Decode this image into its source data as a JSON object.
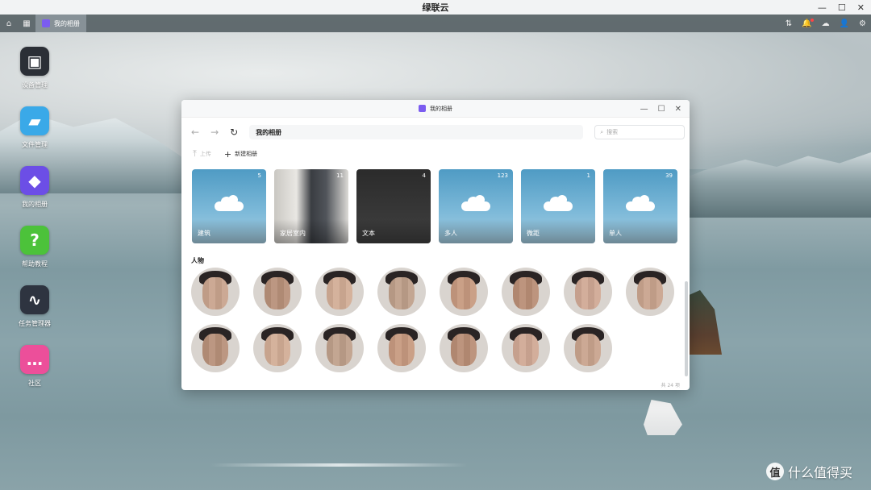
{
  "os": {
    "title": "绿联云",
    "controls": [
      "—",
      "☐",
      "✕"
    ]
  },
  "taskbar": {
    "home_glyph": "⌂",
    "apps_glyph": "▦",
    "active_app": "我的相册",
    "right_glyphs": [
      "⇅",
      "🔔",
      "☁",
      "👤",
      "⚙"
    ]
  },
  "desktop": {
    "items": [
      {
        "label": "设备管理",
        "glyph": "▣",
        "color": "#2b2f36"
      },
      {
        "label": "文件管理",
        "glyph": "▰",
        "color": "#3aa9e8"
      },
      {
        "label": "我的相册",
        "glyph": "◆",
        "color": "#6c4ee6"
      },
      {
        "label": "帮助教程",
        "glyph": "?",
        "color": "#4cc23a"
      },
      {
        "label": "任务管理器",
        "glyph": "∿",
        "color": "#2e3440"
      },
      {
        "label": "社区",
        "glyph": "…",
        "color": "#ec4f9a"
      }
    ]
  },
  "window": {
    "title": "我的相册",
    "controls": [
      "—",
      "☐",
      "✕"
    ],
    "nav": {
      "back": "←",
      "forward": "→",
      "refresh": "↻"
    },
    "path": "我的相册",
    "search_placeholder": "搜索",
    "toolbar": {
      "upload": "上传",
      "new_album": "新建相册"
    },
    "albums": [
      {
        "name": "建筑",
        "count": "5"
      },
      {
        "name": "家居室内",
        "count": "11"
      },
      {
        "name": "文本",
        "count": "4"
      },
      {
        "name": "多人",
        "count": "123"
      },
      {
        "name": "微距",
        "count": "1"
      },
      {
        "name": "单人",
        "count": "39"
      }
    ],
    "people_section_title": "人物",
    "people_count": 15,
    "footer": "共 24 项"
  },
  "watermark": {
    "badge": "值",
    "text": "什么值得买"
  }
}
